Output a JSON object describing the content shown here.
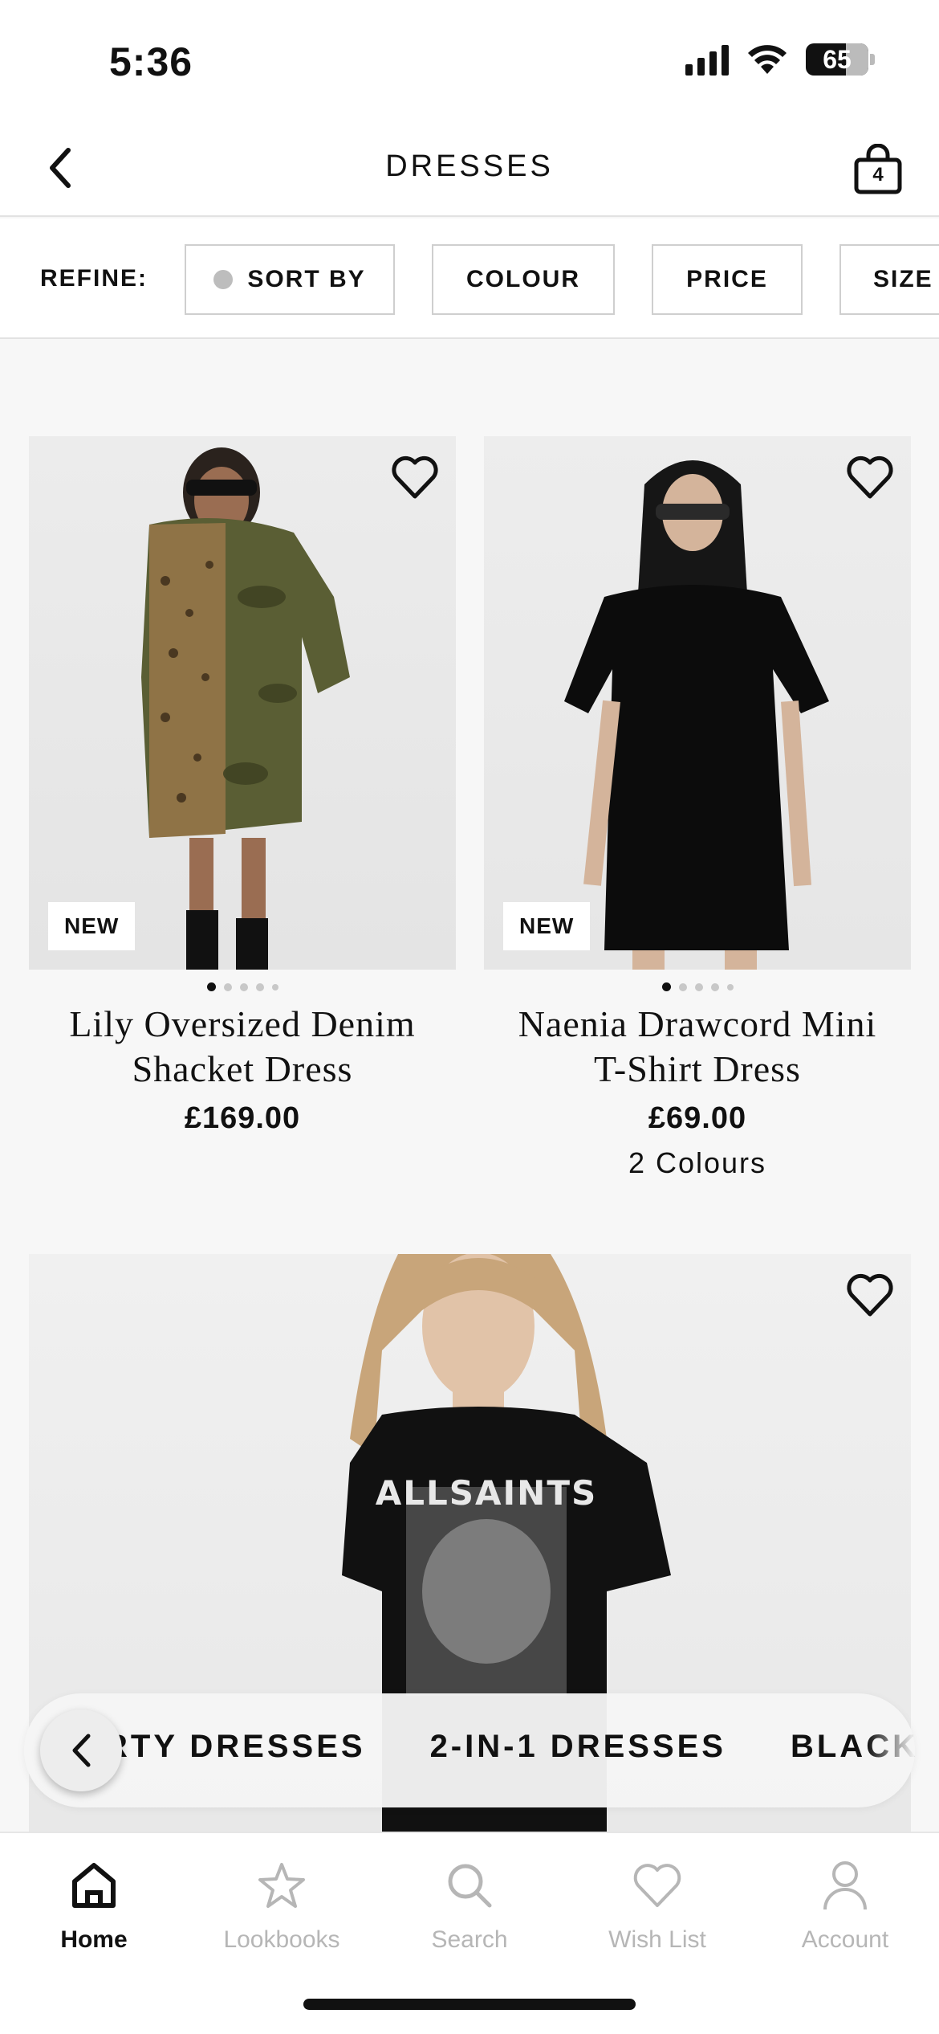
{
  "status": {
    "time": "5:36",
    "battery": "65"
  },
  "header": {
    "title": "DRESSES",
    "bag_count": "4"
  },
  "refine": {
    "label": "REFINE:",
    "filters": [
      "SORT BY",
      "COLOUR",
      "PRICE",
      "SIZE"
    ]
  },
  "products": [
    {
      "name_line1": "Lily Oversized Denim",
      "name_line2": "Shacket Dress",
      "price": "£169.00",
      "badge": "NEW",
      "colours": "",
      "image_count": 5,
      "active_image": 1
    },
    {
      "name_line1": "Naenia Drawcord Mini",
      "name_line2": "T-Shirt Dress",
      "price": "£69.00",
      "badge": "NEW",
      "colours": "2 Colours",
      "image_count": 5,
      "active_image": 1
    },
    {
      "name_line1": "",
      "name_line2": "",
      "price": "",
      "badge": "",
      "colours": "",
      "print_text": "ALLSAINTS"
    }
  ],
  "categories": [
    "RTY DRESSES",
    "2-IN-1 DRESSES",
    "BLACK"
  ],
  "tabs": [
    {
      "label": "Home",
      "icon": "home-icon",
      "active": true
    },
    {
      "label": "Lookbooks",
      "icon": "star-icon",
      "active": false
    },
    {
      "label": "Search",
      "icon": "search-icon",
      "active": false
    },
    {
      "label": "Wish List",
      "icon": "heart-icon",
      "active": false
    },
    {
      "label": "Account",
      "icon": "account-icon",
      "active": false
    }
  ],
  "colors": {
    "accent": "#111111",
    "inactive": "#b6b6b6",
    "background": "#f7f7f7"
  }
}
